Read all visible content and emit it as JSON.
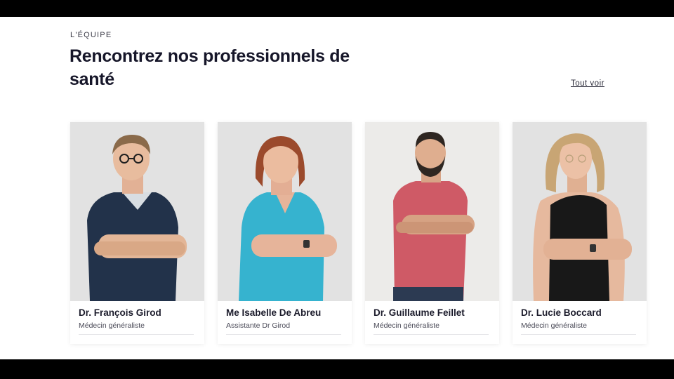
{
  "section": {
    "eyebrow": "L'ÉQUIPE",
    "title": "Rencontrez nos professionnels de santé",
    "see_all": "Tout voir"
  },
  "team": [
    {
      "name": "Dr. François Girod",
      "role": "Médecin généraliste"
    },
    {
      "name": "Me Isabelle De Abreu",
      "role": "Assistante Dr Girod"
    },
    {
      "name": "Dr. Guillaume Feillet",
      "role": "Médecin généraliste"
    },
    {
      "name": "Dr. Lucie Boccard",
      "role": "Médecin généraliste"
    }
  ]
}
